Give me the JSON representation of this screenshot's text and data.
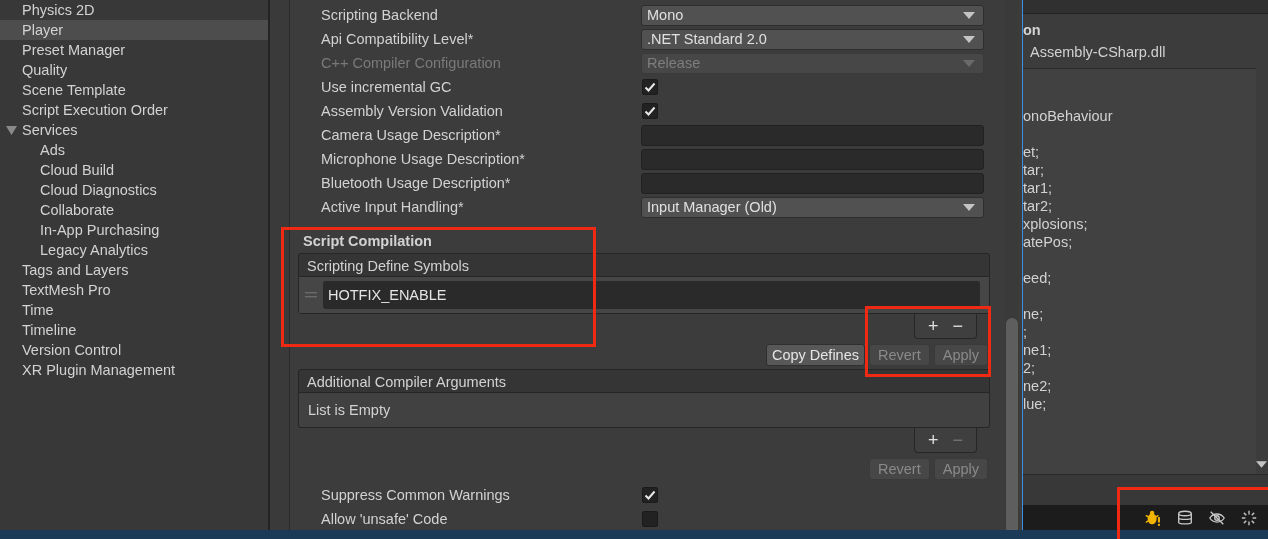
{
  "sidebar": {
    "items": [
      {
        "label": "Physics 2D",
        "selected": false
      },
      {
        "label": "Player",
        "selected": true
      },
      {
        "label": "Preset Manager",
        "selected": false
      },
      {
        "label": "Quality",
        "selected": false
      },
      {
        "label": "Scene Template",
        "selected": false
      },
      {
        "label": "Script Execution Order",
        "selected": false
      },
      {
        "label": "Services",
        "selected": false,
        "expanded": true,
        "children": [
          {
            "label": "Ads",
            "selected": false
          },
          {
            "label": "Cloud Build",
            "selected": false
          },
          {
            "label": "Cloud Diagnostics",
            "selected": false
          },
          {
            "label": "Collaborate",
            "selected": false
          },
          {
            "label": "In-App Purchasing",
            "selected": false
          },
          {
            "label": "Legacy Analytics",
            "selected": false
          }
        ]
      },
      {
        "label": "Tags and Layers",
        "selected": false
      },
      {
        "label": "TextMesh Pro",
        "selected": false
      },
      {
        "label": "Time",
        "selected": false
      },
      {
        "label": "Timeline",
        "selected": false
      },
      {
        "label": "Version Control",
        "selected": false
      },
      {
        "label": "XR Plugin Management",
        "selected": false
      }
    ]
  },
  "settings": [
    {
      "kind": "dropdown",
      "label": "Scripting Backend",
      "value": "Mono",
      "disabled": false
    },
    {
      "kind": "dropdown",
      "label": "Api Compatibility Level*",
      "value": ".NET Standard 2.0",
      "disabled": false
    },
    {
      "kind": "dropdown",
      "label": "C++ Compiler Configuration",
      "value": "Release",
      "disabled": true
    },
    {
      "kind": "checkbox",
      "label": "Use incremental GC",
      "checked": true
    },
    {
      "kind": "checkbox",
      "label": "Assembly Version Validation",
      "checked": true
    },
    {
      "kind": "text",
      "label": "Camera Usage Description*"
    },
    {
      "kind": "text",
      "label": "Microphone Usage Description*"
    },
    {
      "kind": "text",
      "label": "Bluetooth Usage Description*"
    },
    {
      "kind": "dropdown",
      "label": "Active Input Handling*",
      "value": "Input Manager (Old)",
      "disabled": false
    }
  ],
  "script_compilation": {
    "title": "Script Compilation",
    "lists": [
      {
        "header": "Scripting Define Symbols",
        "items": [
          "HOTFIX_ENABLE"
        ],
        "add": "+",
        "remove": {
          "label": "−",
          "disabled": false
        },
        "buttons": [
          {
            "label": "Copy Defines",
            "disabled": false
          },
          {
            "label": "Revert",
            "disabled": true
          },
          {
            "label": "Apply",
            "disabled": true
          }
        ]
      },
      {
        "header": "Additional Compiler Arguments",
        "empty_text": "List is Empty",
        "add": "+",
        "remove": {
          "label": "−",
          "disabled": true
        },
        "buttons": [
          {
            "label": "Revert",
            "disabled": true
          },
          {
            "label": "Apply",
            "disabled": true
          }
        ]
      }
    ]
  },
  "more_settings": [
    {
      "kind": "checkbox",
      "label": "Suppress Common Warnings",
      "checked": true
    },
    {
      "kind": "checkbox",
      "label": "Allow 'unsafe' Code",
      "checked": false
    }
  ],
  "code_panel": {
    "heading": "on",
    "assembly": "Assembly-CSharp.dll",
    "blocks": [
      [
        "onoBehaviour"
      ],
      [
        "et;",
        "tar;",
        "tar1;",
        "tar2;",
        "xplosions;",
        "atePos;"
      ],
      [
        "eed;"
      ],
      [
        "ne;",
        ";",
        "ne1;",
        "2;",
        "ne2;",
        "lue;"
      ]
    ]
  }
}
